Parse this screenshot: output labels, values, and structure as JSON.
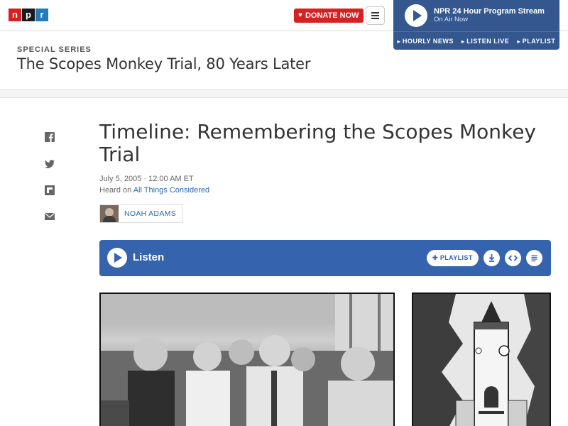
{
  "header": {
    "logo": [
      "n",
      "p",
      "r"
    ],
    "donate_label": "DONATE NOW",
    "stream": {
      "title": "NPR 24 Hour Program Stream",
      "subtitle": "On Air Now",
      "links": [
        "HOURLY NEWS",
        "LISTEN LIVE",
        "PLAYLIST"
      ]
    }
  },
  "series": {
    "kicker": "SPECIAL SERIES",
    "title": "The Scopes Monkey Trial, 80 Years Later"
  },
  "share": [
    "facebook-icon",
    "twitter-icon",
    "flipboard-icon",
    "email-icon"
  ],
  "article": {
    "headline": "Timeline: Remembering the Scopes Monkey Trial",
    "date": "July 5, 2005 · 12:00 AM ET",
    "heard_on_prefix": "Heard on ",
    "heard_on_program": "All Things Considered",
    "author": "NOAH ADAMS"
  },
  "player": {
    "listen_label": "Listen",
    "playlist_label": "PLAYLIST",
    "icons": [
      "download-icon",
      "embed-icon",
      "transcript-icon"
    ]
  },
  "colors": {
    "npr_red": "#d62021",
    "npr_blue": "#237bbd",
    "stream_bg": "#34578f",
    "player_bg": "#3563ae",
    "link": "#2a6bb0"
  }
}
